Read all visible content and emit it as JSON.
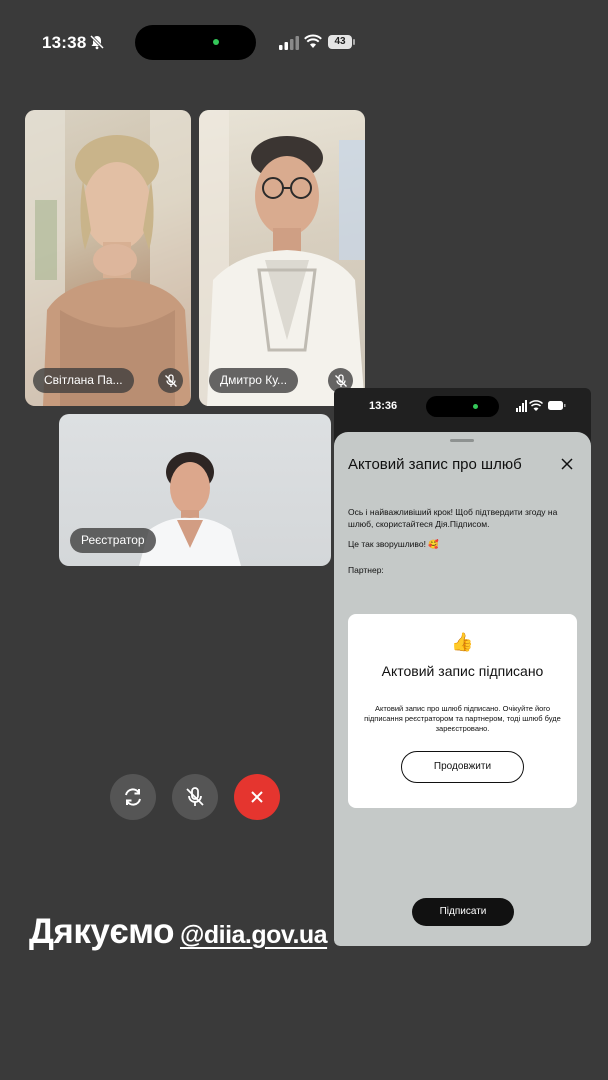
{
  "status_bar": {
    "time": "13:38",
    "battery": "43"
  },
  "call": {
    "participants": [
      {
        "name": "Світлана Па..."
      },
      {
        "name": "Дмитро Ку..."
      },
      {
        "name": "Реєстратор"
      }
    ]
  },
  "caption": {
    "thanks": "Дякуємо",
    "link": "@diia.gov.ua"
  },
  "phone": {
    "time": "13:36",
    "sheet": {
      "title": "Актовий запис про шлюб",
      "intro": "Ось і найважливіший крок! Щоб підтвердити згоду на шлюб, скористайтеся Дія.Підписом.",
      "touching": "Це так зворушливо! 🥰",
      "partner_label": "Партнер:",
      "sign_button": "Підписати"
    },
    "modal": {
      "emoji": "👍",
      "title": "Актовий запис підписано",
      "text": "Актовий запис про шлюб підписано. Очікуйте його підписання реєстратором та партнером, тоді шлюб буде зареєстровано.",
      "continue_button": "Продовжити"
    }
  },
  "colors": {
    "background": "#3a3a3a",
    "end_call": "#e5352f",
    "sheet": "#c5c9c8"
  }
}
